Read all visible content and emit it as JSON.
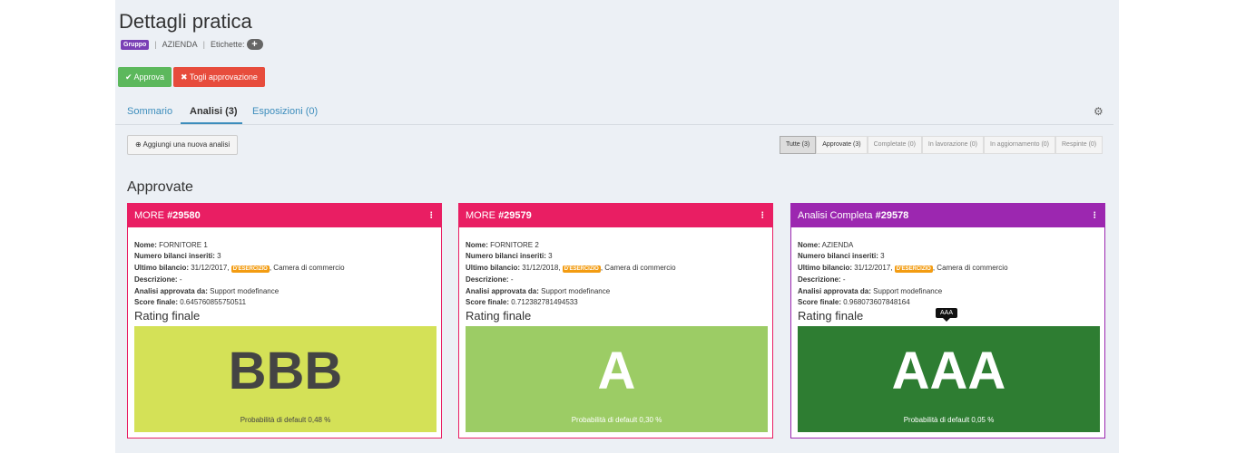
{
  "header": {
    "title": "Dettagli pratica",
    "gruppo_badge": "Gruppo",
    "azienda": "AZIENDA",
    "etichette_label": "Etichette:",
    "plus": "+"
  },
  "actions": {
    "approva": "✔ Approva",
    "togli": "✖ Togli approvazione"
  },
  "tabs": [
    {
      "label": "Sommario"
    },
    {
      "label": "Analisi (3)"
    },
    {
      "label": "Esposizioni (0)"
    }
  ],
  "add_analysis": "⊕ Aggiungi una nuova analisi",
  "filters": [
    "Tutte (3)",
    "Approvate (3)",
    "Completate (0)",
    "In lavorazione (0)",
    "In aggiornamento (0)",
    "Respinte (0)"
  ],
  "section_title": "Approvate",
  "labels": {
    "nome": "Nome:",
    "numero": "Numero bilanci inseriti:",
    "ultimo": "Ultimo bilancio:",
    "descrizione": "Descrizione:",
    "approvata": "Analisi approvata da:",
    "score": "Score finale:",
    "rating": "Rating finale",
    "esercizio": "D'ESERCIZIO",
    "kebab": "⁝"
  },
  "cards": [
    {
      "header_prefix": "MORE ",
      "header_id": "#29580",
      "nome": "FORNITORE 1",
      "numero": "3",
      "ultimo_date": "31/12/2017,",
      "ultimo_source": ", Camera di commercio",
      "descrizione": "-",
      "approvata": "Support modefinance",
      "score": "0.645760855750511",
      "rating": "BBB",
      "prob": "Probabilità di default 0,48 %",
      "header_color": "#e91e63",
      "rating_color": "#d4e157"
    },
    {
      "header_prefix": "MORE ",
      "header_id": "#29579",
      "nome": "FORNITORE 2",
      "numero": "3",
      "ultimo_date": "31/12/2018,",
      "ultimo_source": ", Camera di commercio",
      "descrizione": "-",
      "approvata": "Support modefinance",
      "score": "0.712382781494533",
      "rating": "A",
      "prob": "Probabilità di default 0,30 %",
      "header_color": "#e91e63",
      "rating_color": "#9ccc65"
    },
    {
      "header_prefix": "Analisi Completa ",
      "header_id": "#29578",
      "nome": "AZIENDA",
      "numero": "3",
      "ultimo_date": "31/12/2017,",
      "ultimo_source": ", Camera di commercio",
      "descrizione": "-",
      "approvata": "Support modefinance",
      "score": "0.968073607848164",
      "rating": "AAA",
      "prob": "Probabilità di default 0,05 %",
      "header_color": "#9c27b0",
      "rating_color": "#2e7d32"
    }
  ],
  "tooltip": "AAA"
}
